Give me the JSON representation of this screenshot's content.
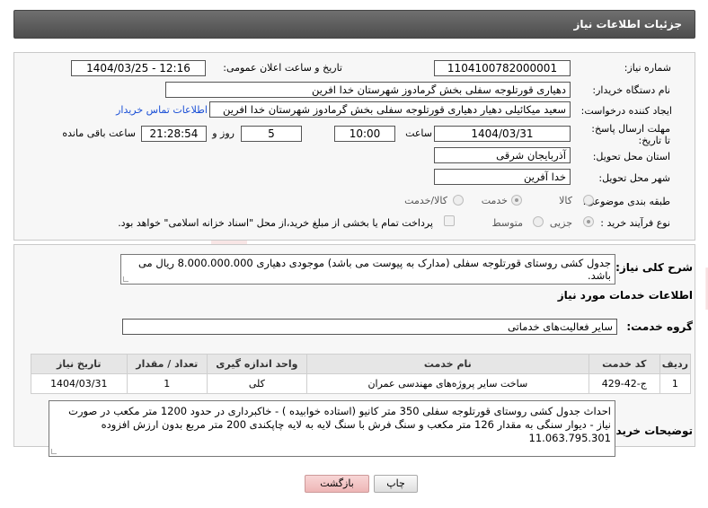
{
  "header": {
    "title": "جزئیات اطلاعات نیاز"
  },
  "fields": {
    "need_number_label": "شماره نیاز:",
    "need_number": "1104100782000001",
    "announce_label": "تاریخ و ساعت اعلان عمومی:",
    "announce_value": "1404/03/25 - 12:16",
    "buyer_org_label": "نام دستگاه خریدار:",
    "buyer_org": "دهیاری قورتلوجه سفلی بخش گرمادوز شهرستان خدا افرین",
    "creator_label": "ایجاد کننده درخواست:",
    "creator": "سعید میکائیلی دهیار دهیاری قورتلوجه سفلی بخش گرمادوز شهرستان خدا افرین",
    "contact_link": "اطلاعات تماس خریدار",
    "deadline_label": "مهلت ارسال پاسخ: تا تاریخ:",
    "deadline_date": "1404/03/31",
    "time_label": "ساعت",
    "deadline_time": "10:00",
    "days_value": "5",
    "days_label": "روز و",
    "remaining_time": "21:28:54",
    "remaining_label": "ساعت باقی مانده",
    "province_label": "استان محل تحویل:",
    "province": "آذربایجان شرقی",
    "city_label": "شهر محل تحویل:",
    "city": "خدا آفرین",
    "category_label": "طبقه بندی موضوعی:",
    "category_options": [
      "کالا",
      "خدمت",
      "کالا/خدمت"
    ],
    "category_selected": "خدمت",
    "process_label": "نوع فرآیند خرید :",
    "process_options": [
      "جزیی",
      "متوسط"
    ],
    "process_selected": "جزیی",
    "payment_note": "پرداخت تمام یا بخشی از مبلغ خرید،از محل \"اسناد خزانه اسلامی\" خواهد بود."
  },
  "summary": {
    "label": "شرح کلی نیاز:",
    "text": "جدول کشی روستای قورتلوجه سفلی (مدارک به پیوست می باشد) موجودی دهیاری 8.000.000.000 ریال می باشد."
  },
  "services": {
    "section_title": "اطلاعات خدمات مورد نیاز",
    "group_label": "گروه خدمت:",
    "group_value": "سایر فعالیت‌های خدماتی",
    "columns": [
      "ردیف",
      "کد خدمت",
      "نام خدمت",
      "واحد اندازه گیری",
      "تعداد / مقدار",
      "تاریخ نیاز"
    ],
    "rows": [
      [
        "1",
        "ج-42-429",
        "ساخت سایر پروژه‌های مهندسی عمران",
        "کلی",
        "1",
        "1404/03/31"
      ]
    ]
  },
  "buyer_notes": {
    "label": "توضیحات خریدار:",
    "text": "احداث جدول کشی روستای قورتلوجه سفلی  350 متر کانیو (استاده خوابیده ) -  خاکبرداری در حدود 1200 متر مکعب در صورت نیاز -  دیوار سنگی به مقدار 126 متر مکعب و سنگ فرش با سنگ لایه به لایه چاپکندی 200 متر مربع  بدون ارزش افزوده 11.063.795.301"
  },
  "buttons": {
    "print": "چاپ",
    "back": "بازگشت"
  },
  "watermark_text": "AriaTender.net",
  "colors": {
    "header": "#5a5a5a",
    "link": "#1a4fd6",
    "back_button": "#f3c3c3"
  }
}
